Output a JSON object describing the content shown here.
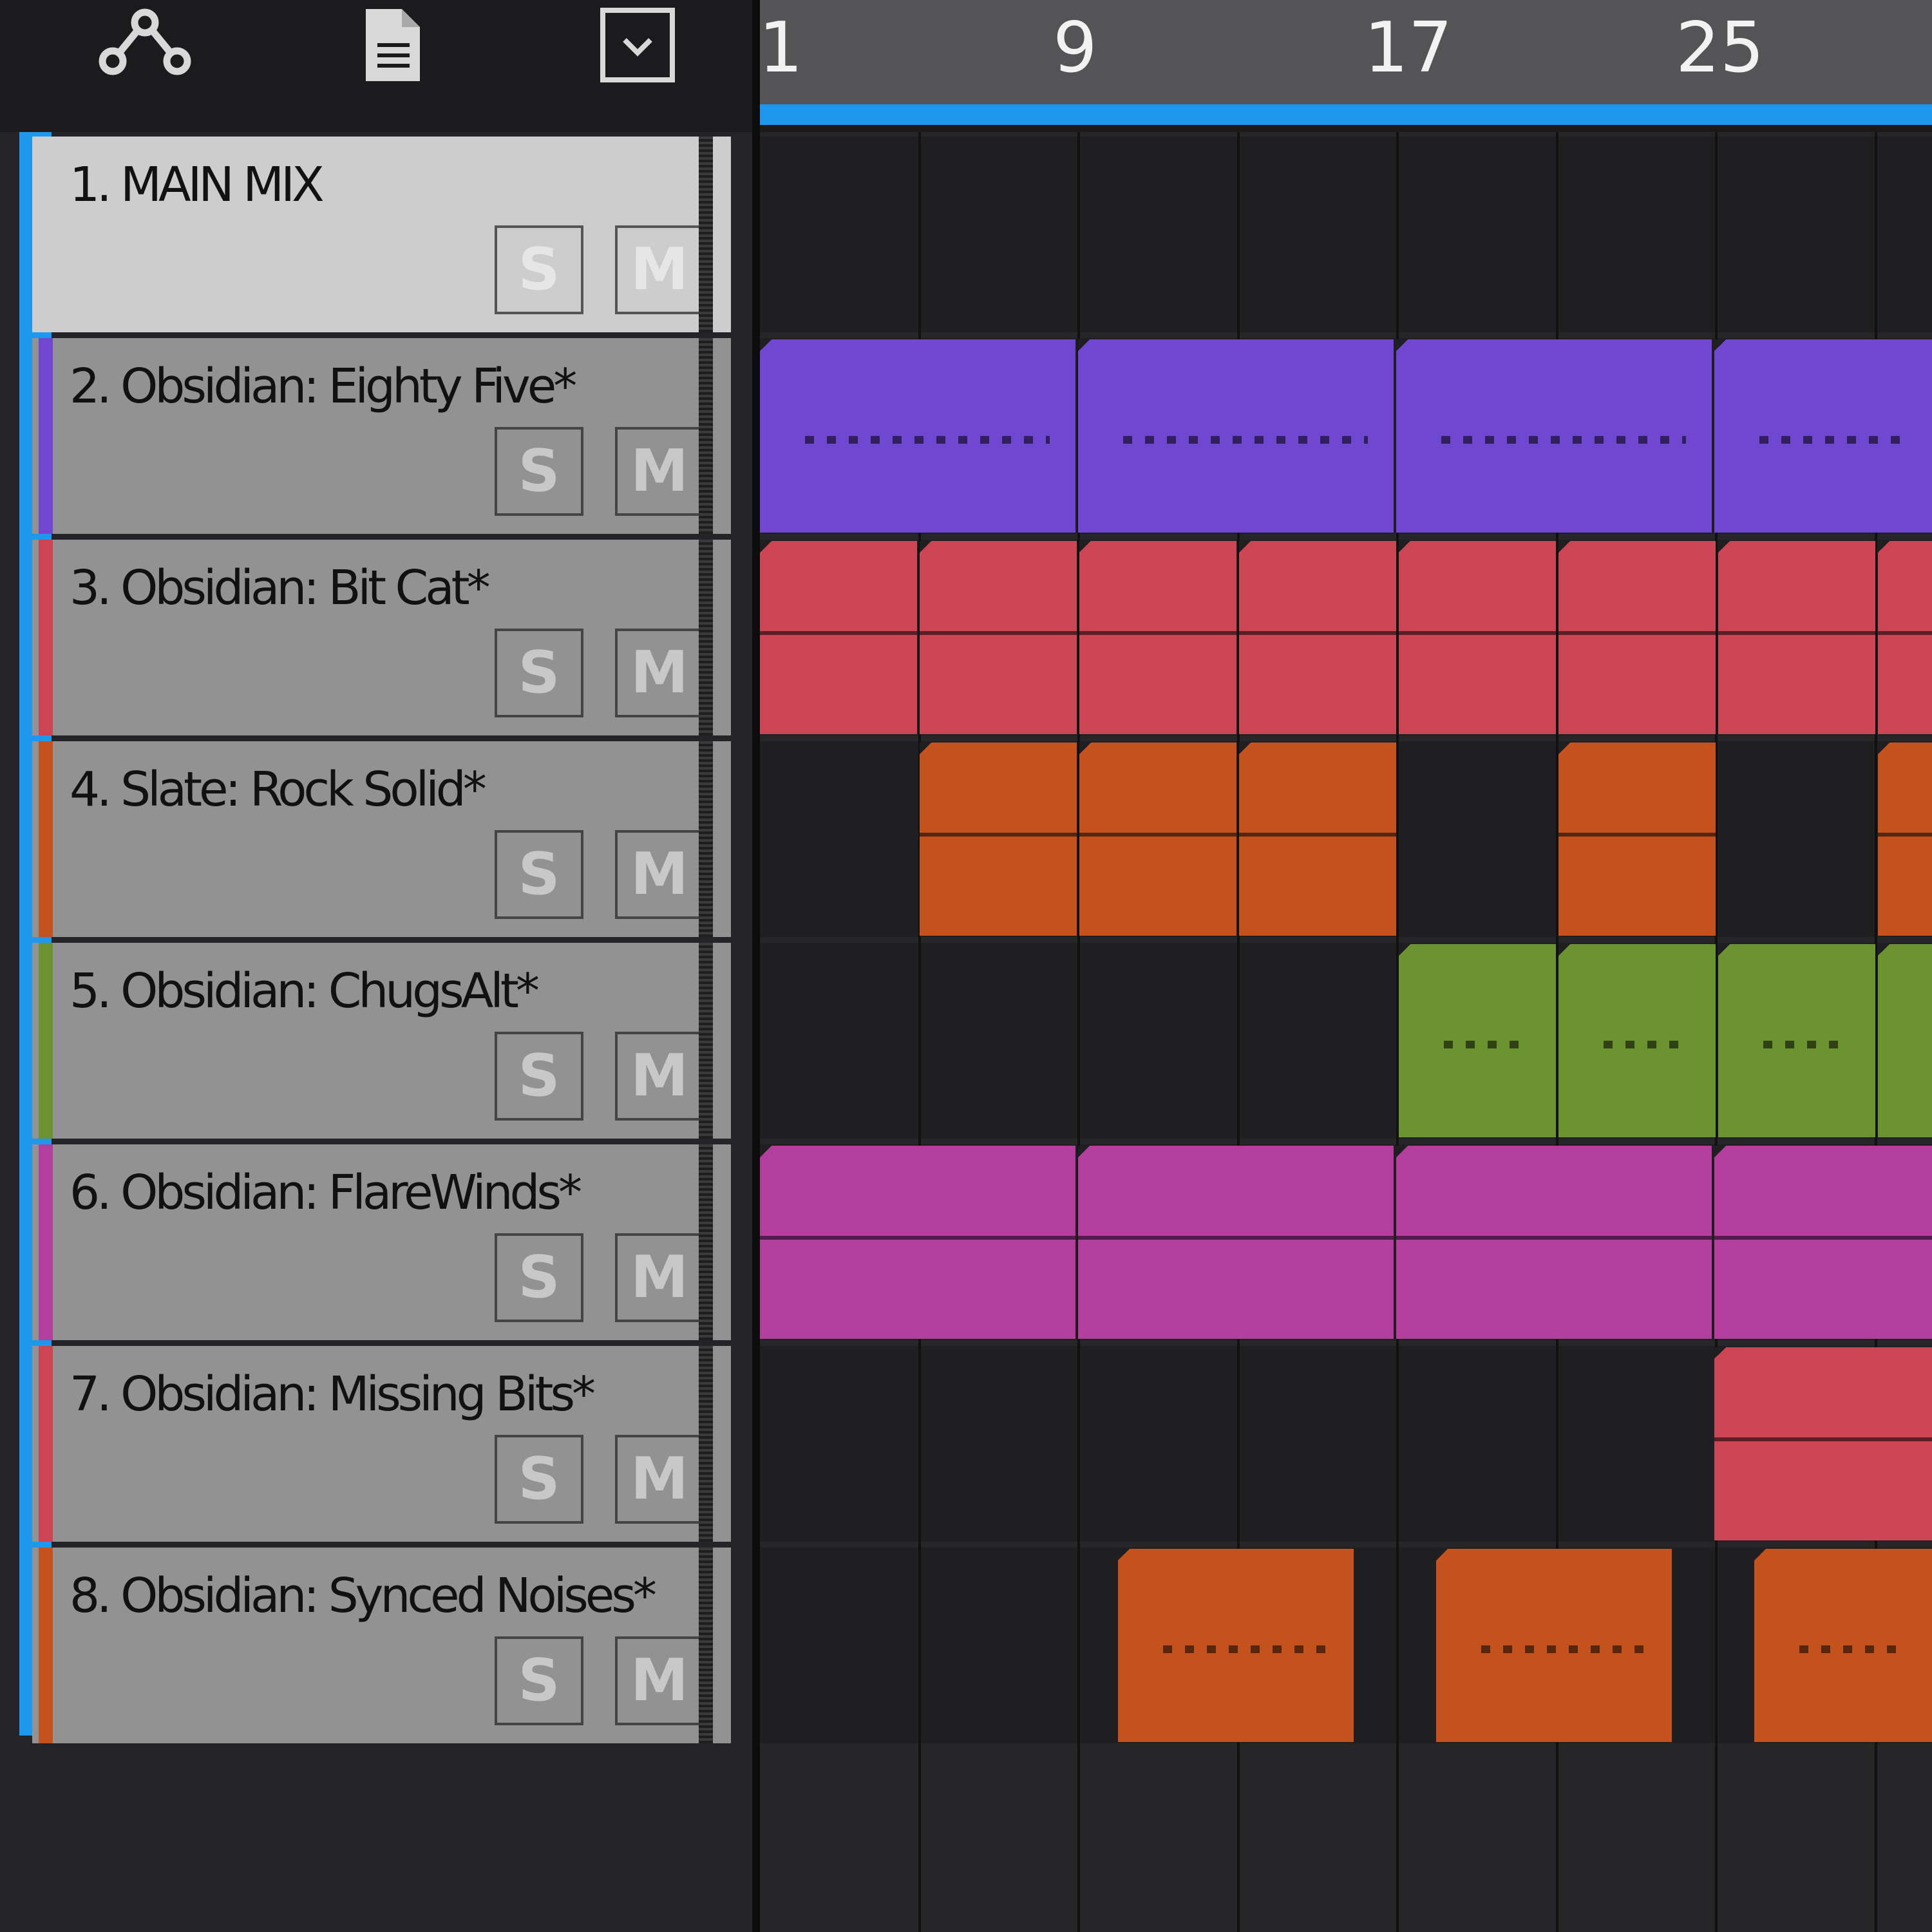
{
  "toolbar": {
    "icons": [
      "routing-icon",
      "document-icon",
      "dropdown-icon"
    ]
  },
  "ruler": {
    "marks": [
      "1",
      "9",
      "17",
      "25"
    ],
    "playhead_progress": 1.0
  },
  "colors": {
    "accent": "#1e97ef",
    "purple": "#6f47d1",
    "red": "#cc4554",
    "orange": "#c4521d",
    "green": "#6b932f",
    "magenta": "#b33e9e"
  },
  "tracks": [
    {
      "name": "1. MAIN MIX",
      "solo": "S",
      "mute": "M",
      "color": "#1e97ef"
    },
    {
      "name": "2. Obsidian: Eighty Five*",
      "solo": "S",
      "mute": "M",
      "color": "#6f47d1"
    },
    {
      "name": "3. Obsidian: Bit Cat*",
      "solo": "S",
      "mute": "M",
      "color": "#cc4554"
    },
    {
      "name": "4. Slate: Rock Solid*",
      "solo": "S",
      "mute": "M",
      "color": "#c4521d"
    },
    {
      "name": "5. Obsidian: ChugsAlt*",
      "solo": "S",
      "mute": "M",
      "color": "#6b932f"
    },
    {
      "name": "6. Obsidian: FlareWinds*",
      "solo": "S",
      "mute": "M",
      "color": "#b33e9e"
    },
    {
      "name": "7. Obsidian: Missing Bits*",
      "solo": "S",
      "mute": "M",
      "color": "#cc4554"
    },
    {
      "name": "8. Obsidian: Synced Noises*",
      "solo": "S",
      "mute": "M",
      "color": "#c4521d"
    }
  ]
}
